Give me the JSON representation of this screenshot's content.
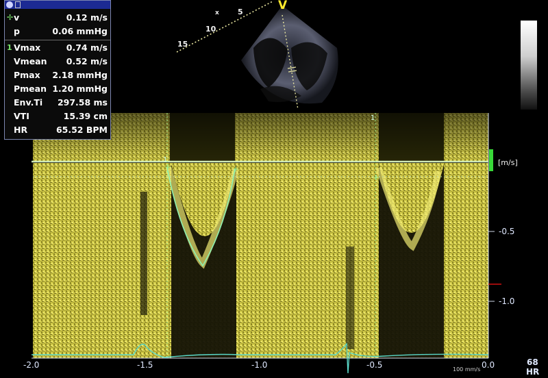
{
  "measurements": {
    "cursor": [
      {
        "label": "v",
        "value": "0.12 m/s"
      },
      {
        "label": "p",
        "value": "0.06 mmHg"
      }
    ],
    "trace_number": "1",
    "trace": [
      {
        "label": "Vmax",
        "value": "0.74 m/s"
      },
      {
        "label": "Vmean",
        "value": "0.52 m/s"
      },
      {
        "label": "Pmax",
        "value": "2.18 mmHg"
      },
      {
        "label": "Pmean",
        "value": "1.20 mmHg"
      },
      {
        "label": "Env.Ti",
        "value": "297.58 ms"
      },
      {
        "label": "VTI",
        "value": "15.39 cm"
      },
      {
        "label": "HR",
        "value": "65.52 BPM"
      }
    ]
  },
  "sector": {
    "beam_label": "V",
    "depth_marks": [
      "15",
      "10",
      "5"
    ],
    "focus_mark": "x"
  },
  "velocity_scale": {
    "unit": "[m/s]",
    "ticks": [
      "-0.5",
      "-1.0"
    ]
  },
  "time_axis": {
    "ticks": [
      "-2.0",
      "-1.5",
      "-1.0",
      "-0.5",
      "0.0"
    ],
    "sweep_speed": "100 mm/s"
  },
  "heart_rate": {
    "value": "68",
    "label": "HR"
  },
  "markers": {
    "cursor_1": "1",
    "cursor_2": "1"
  },
  "colors": {
    "spectrum": "#d8d24a",
    "trace": "#8ff0b0",
    "baseline": "#cfe8b8",
    "accent_green": "#38d838",
    "panel_title": "#1c2a93",
    "beam_label": "#ffea2d"
  },
  "icons": [
    "gear-icon",
    "document-icon",
    "cross-cursor-icon"
  ]
}
